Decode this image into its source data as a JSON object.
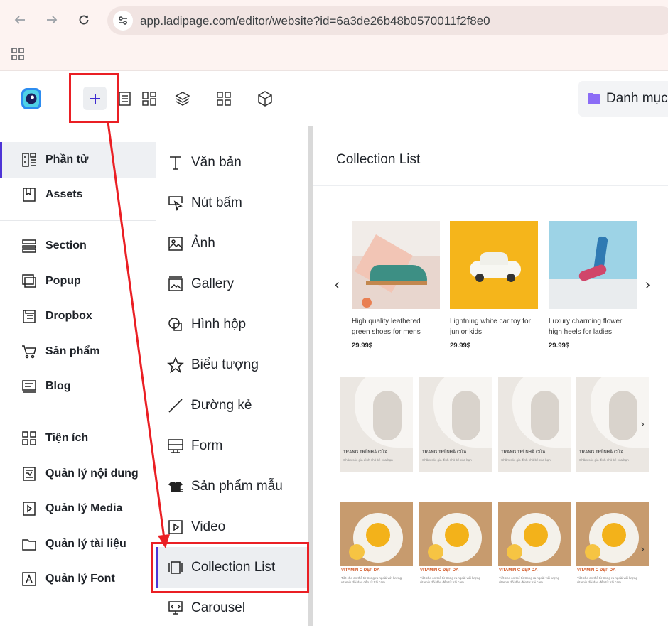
{
  "browser": {
    "url": "app.ladipage.com/editor/website?id=6a3de26b48b0570011f2f8e0"
  },
  "topbar": {
    "category_label": "Danh mục"
  },
  "left_panel": {
    "items": [
      {
        "label": "Phần tử"
      },
      {
        "label": "Assets"
      },
      {
        "label": "Section"
      },
      {
        "label": "Popup"
      },
      {
        "label": "Dropbox"
      },
      {
        "label": "Sản phẩm"
      },
      {
        "label": "Blog"
      },
      {
        "label": "Tiện ích"
      },
      {
        "label": "Quản lý nội dung"
      },
      {
        "label": "Quản lý Media"
      },
      {
        "label": "Quản lý tài liệu"
      },
      {
        "label": "Quản lý Font"
      }
    ]
  },
  "elements_panel": {
    "items": [
      {
        "label": "Văn bản"
      },
      {
        "label": "Nút bấm"
      },
      {
        "label": "Ảnh"
      },
      {
        "label": "Gallery"
      },
      {
        "label": "Hình hộp"
      },
      {
        "label": "Biểu tượng"
      },
      {
        "label": "Đường kẻ"
      },
      {
        "label": "Form"
      },
      {
        "label": "Sản phẩm mẫu"
      },
      {
        "label": "Video"
      },
      {
        "label": "Collection List"
      },
      {
        "label": "Carousel"
      }
    ]
  },
  "preview": {
    "title": "Collection List",
    "products": [
      {
        "name": "High quality leathered green shoes for mens",
        "price": "29.99$"
      },
      {
        "name": "Lightning white car toy for junior kids",
        "price": "29.99$"
      },
      {
        "name": "Luxury charming flower high heels for ladies",
        "price": "29.99$"
      }
    ],
    "deco_caption": "TRANG TRÍ NHÀ CỬA",
    "deco_sub": "Chăm sóc gia đình nhỏ bé của bạn",
    "food_caption": "VITAMIN C ĐẸP DA",
    "food_sub": "Tiết cho cơ thể từ trong ra ngoài với lượng vitamin dồi dào đến từ trái cam."
  },
  "colors": {
    "accent": "#4e35d6",
    "highlight": "#ea1f24",
    "browser_bar": "#fdf3f1"
  }
}
